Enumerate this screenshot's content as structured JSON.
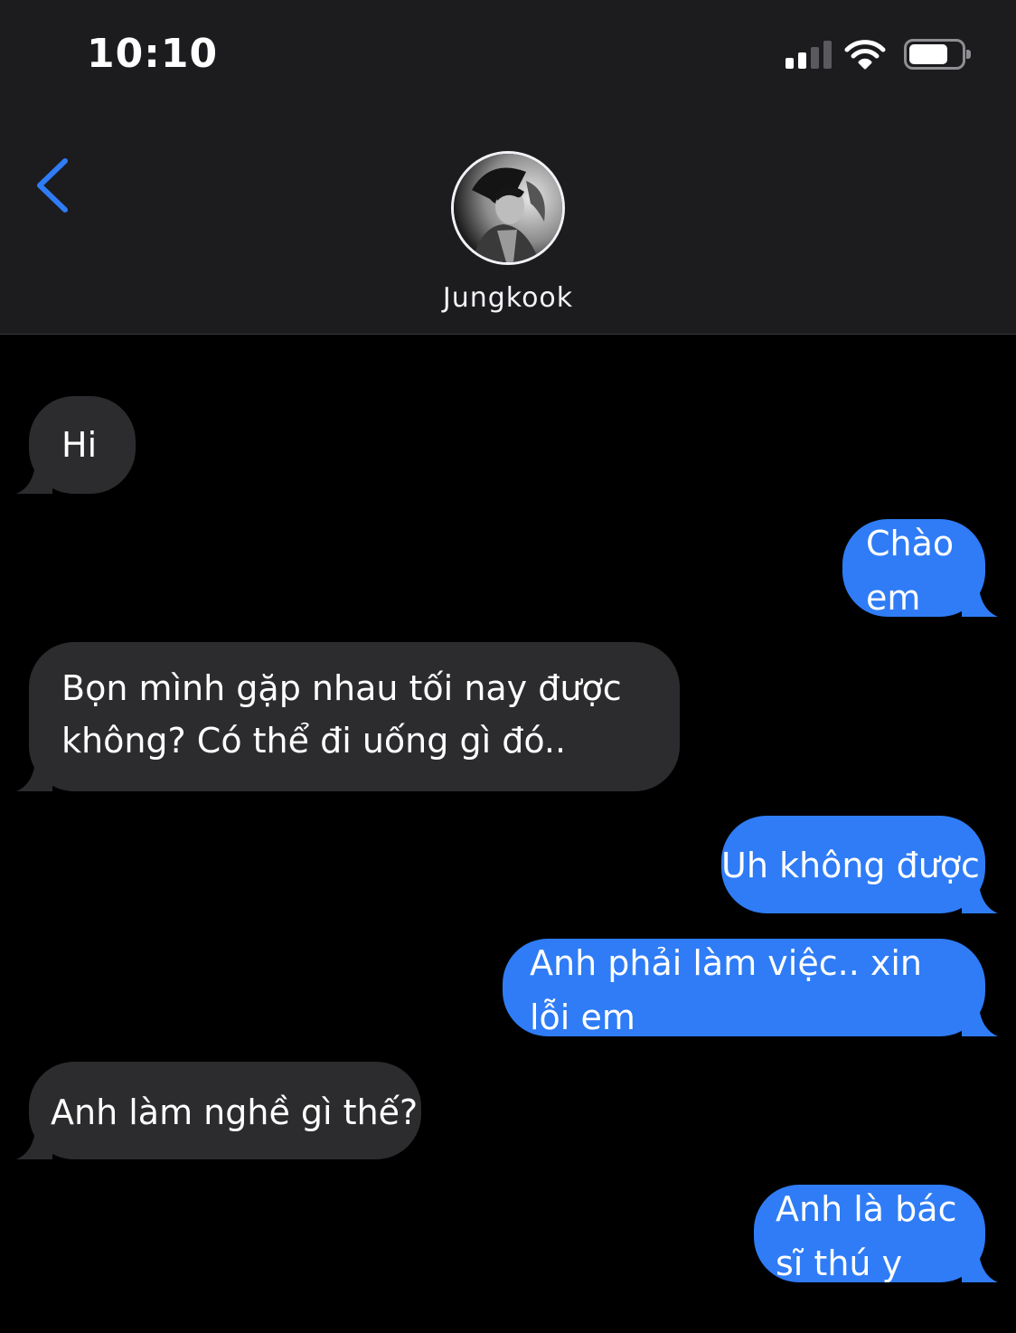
{
  "status_bar": {
    "time": "10:10",
    "signal_icon": "cellular-signal-icon",
    "wifi_icon": "wifi-icon",
    "battery_icon": "battery-icon",
    "signal_bars_active": 2,
    "signal_bars_total": 4,
    "battery_level_percent": 75
  },
  "header": {
    "back_icon": "chevron-left-icon",
    "contact_name": "Jungkook",
    "avatar_icon": "contact-avatar-photo"
  },
  "colors": {
    "accent": "#2f7cf6",
    "incoming_bubble": "#2c2c2e",
    "header_bg": "#1c1c1e",
    "background": "#000000"
  },
  "messages": [
    {
      "direction": "incoming",
      "lines": [
        "Hi"
      ]
    },
    {
      "direction": "outgoing",
      "lines": [
        "Chào",
        "em"
      ]
    },
    {
      "direction": "incoming",
      "lines": [
        "Bọn mình gặp nhau tối nay được",
        "không? Có thể đi uống gì đó.."
      ]
    },
    {
      "direction": "outgoing",
      "lines": [
        "Uh không được"
      ]
    },
    {
      "direction": "outgoing",
      "lines": [
        "Anh phải làm việc.. xin",
        "lỗi em"
      ]
    },
    {
      "direction": "incoming",
      "lines": [
        "Anh làm nghề gì thế?"
      ]
    },
    {
      "direction": "outgoing",
      "lines": [
        "Anh là bác",
        "sĩ thú y"
      ]
    }
  ]
}
